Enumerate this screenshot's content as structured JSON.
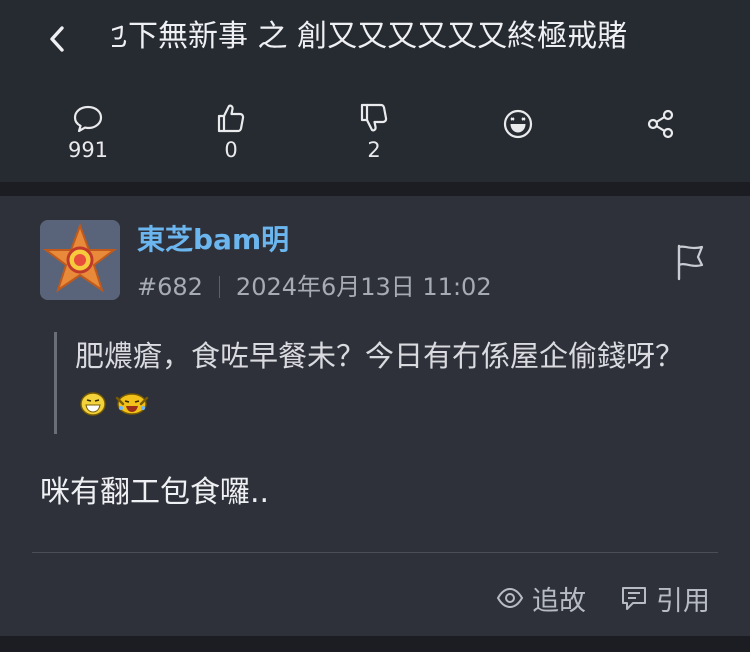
{
  "header": {
    "title": "乜下無新事 之 創又又又又又又終極戒賭",
    "stats": [
      {
        "icon": "comment-icon",
        "value": "991"
      },
      {
        "icon": "thumbs-up-icon",
        "value": "0"
      },
      {
        "icon": "thumbs-down-icon",
        "value": "2"
      },
      {
        "icon": "laugh-emoji-icon",
        "value": ""
      },
      {
        "icon": "share-icon",
        "value": ""
      }
    ]
  },
  "post": {
    "username": "東芝bam明",
    "floor": "#682",
    "date": "2024年6月13日 11:02",
    "quote": "肥燶瘡，食咗早餐未？今日有冇係屋企偷錢呀？",
    "reply": "咪有翻工包食囉..",
    "actions": {
      "follow_label": "追故",
      "quote_label": "引用"
    }
  },
  "colors": {
    "background": "#22252b",
    "card": "#2e3139",
    "username": "#6cb6f0",
    "meta": "#a7abb4"
  }
}
